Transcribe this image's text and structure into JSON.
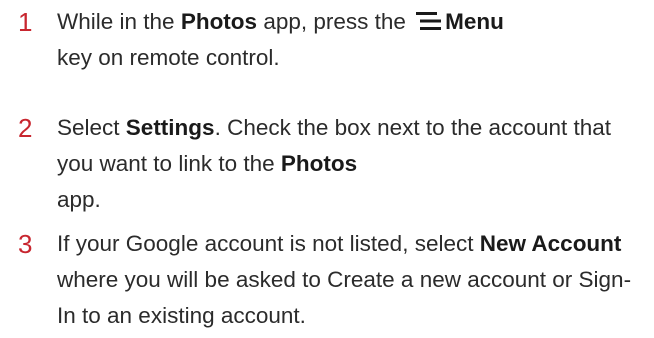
{
  "steps": [
    {
      "number": "1",
      "parts": {
        "a": "While in the ",
        "b": "Photos",
        "c": " app, press the ",
        "d": "Menu",
        "e": "key on remote control."
      },
      "icon": "menu-icon"
    },
    {
      "number": "2",
      "parts": {
        "a": "Select ",
        "b": "Settings",
        "c": ". Check the box next to the account that you want to link to the ",
        "d": "Photos",
        "e": "app."
      }
    },
    {
      "number": "3",
      "parts": {
        "a": "If your Google account is not listed, select ",
        "b": "New Account",
        "c": " where you will be asked to Create a new account or Sign-In to an existing account."
      }
    }
  ],
  "colors": {
    "step_number": "#c8262f",
    "text": "#2b2b2b"
  }
}
